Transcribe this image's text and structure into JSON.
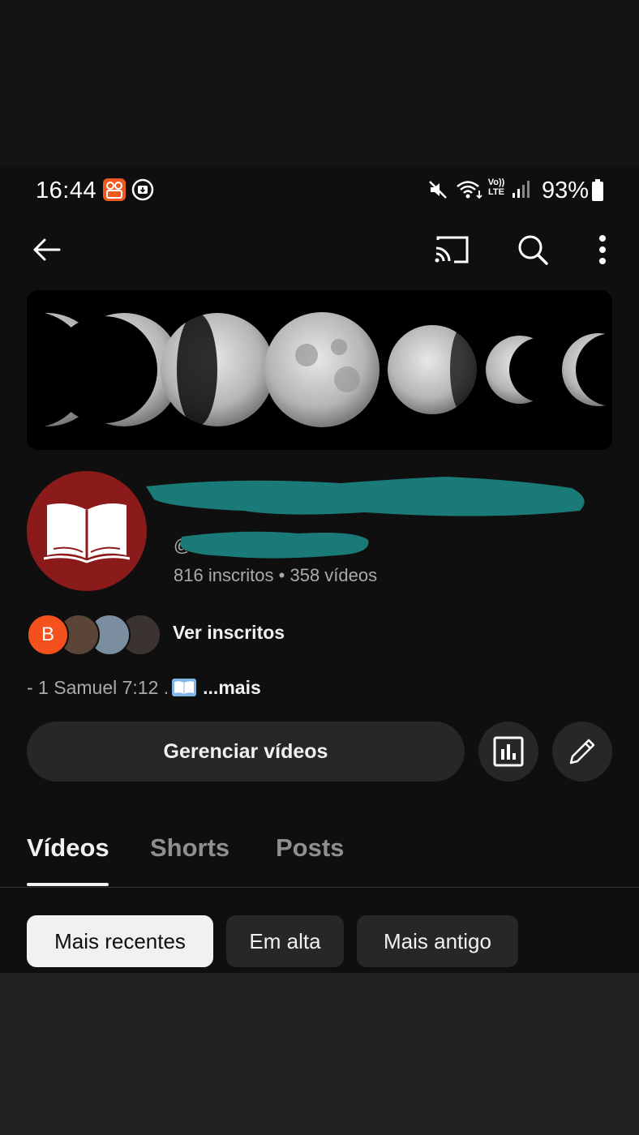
{
  "status_bar": {
    "time": "16:44",
    "battery": "93%",
    "signal_label": "Vo)) LTE"
  },
  "app_bar": {
    "back_icon": "arrow-left-icon",
    "cast_icon": "cast-icon",
    "search_icon": "search-icon",
    "more_icon": "more-vertical-icon"
  },
  "channel": {
    "handle_prefix": "@",
    "subscribers": "816 inscritos",
    "separator": "•",
    "videos": "358 vídeos",
    "avatar_icon": "open-book-icon"
  },
  "subscribers_row": {
    "first_initial": "B",
    "label": "Ver inscritos"
  },
  "description": {
    "text": "- 1 Samuel 7:12 .",
    "more": "...mais"
  },
  "actions": {
    "manage_label": "Gerenciar vídeos",
    "analytics_icon": "analytics-icon",
    "edit_icon": "pencil-icon"
  },
  "tabs": [
    {
      "label": "Vídeos",
      "active": true
    },
    {
      "label": "Shorts",
      "active": false
    },
    {
      "label": "Posts",
      "active": false
    }
  ],
  "filters": [
    {
      "label": "Mais recentes",
      "selected": true
    },
    {
      "label": "Em alta",
      "selected": false
    },
    {
      "label": "Mais antigo",
      "selected": false
    }
  ],
  "colors": {
    "background": "#0f0f0f",
    "avatar_bg": "#8b1a1a",
    "scribble": "#1a7a78",
    "subscriber_b": "#f4511e",
    "status_app_orange": "#f05a22"
  }
}
